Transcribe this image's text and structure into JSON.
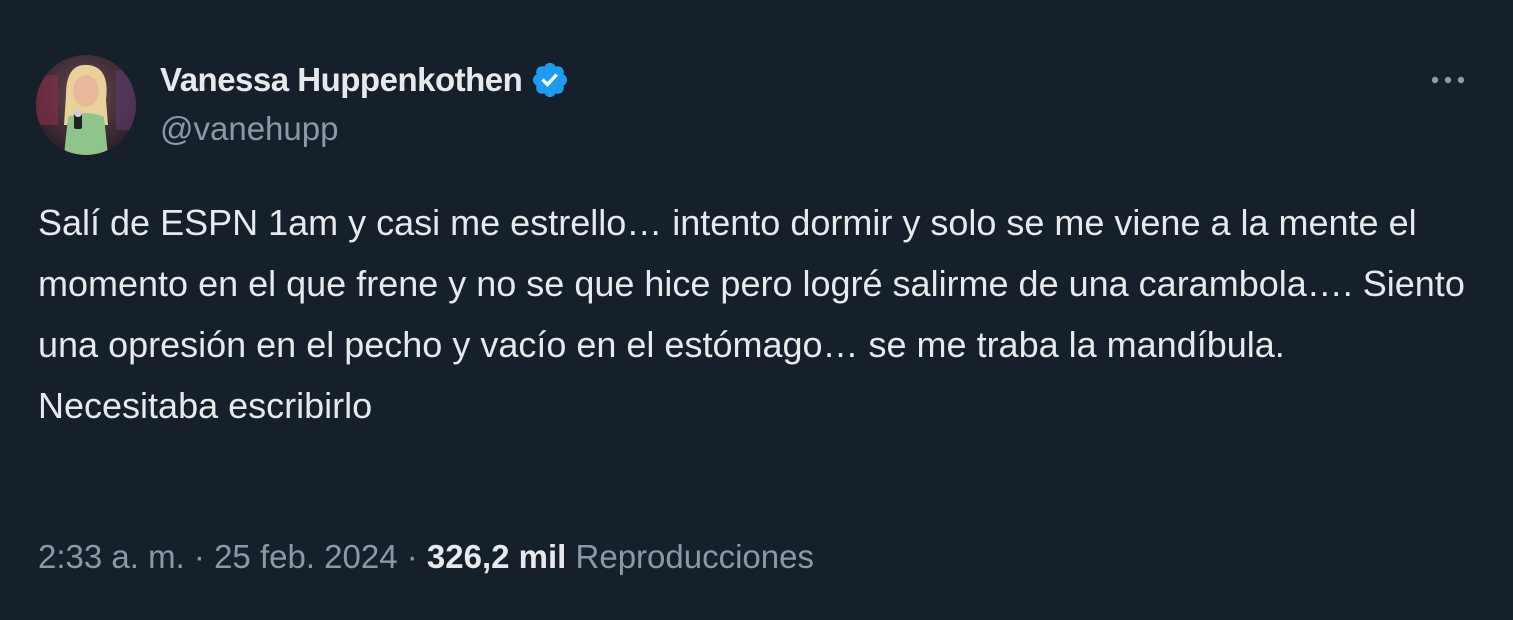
{
  "colors": {
    "background": "#15202b",
    "text_primary": "#e7e9ea",
    "text_secondary": "#8b98a5",
    "verified_badge": "#1d9bf0"
  },
  "author": {
    "display_name": "Vanessa Huppenkothen",
    "handle": "@vanehupp",
    "verified": true,
    "avatar_icon": "profile-photo",
    "badge_icon": "verified-badge-icon"
  },
  "menu": {
    "icon": "more-options-icon"
  },
  "tweet": {
    "text": "Salí de ESPN 1am y casi me estrello… intento dormir y solo se me viene a la mente el momento en el que frene y no se que hice pero logré salirme de una carambola…. Siento una opresión en el pecho y vacío en el estómago… se me traba la mandíbula.\nNecesitaba escribirlo"
  },
  "meta": {
    "time": "2:33 a. m.",
    "separator": " · ",
    "date": "25 feb. 2024",
    "views_count": "326,2 mil",
    "views_label": "Reproducciones"
  }
}
